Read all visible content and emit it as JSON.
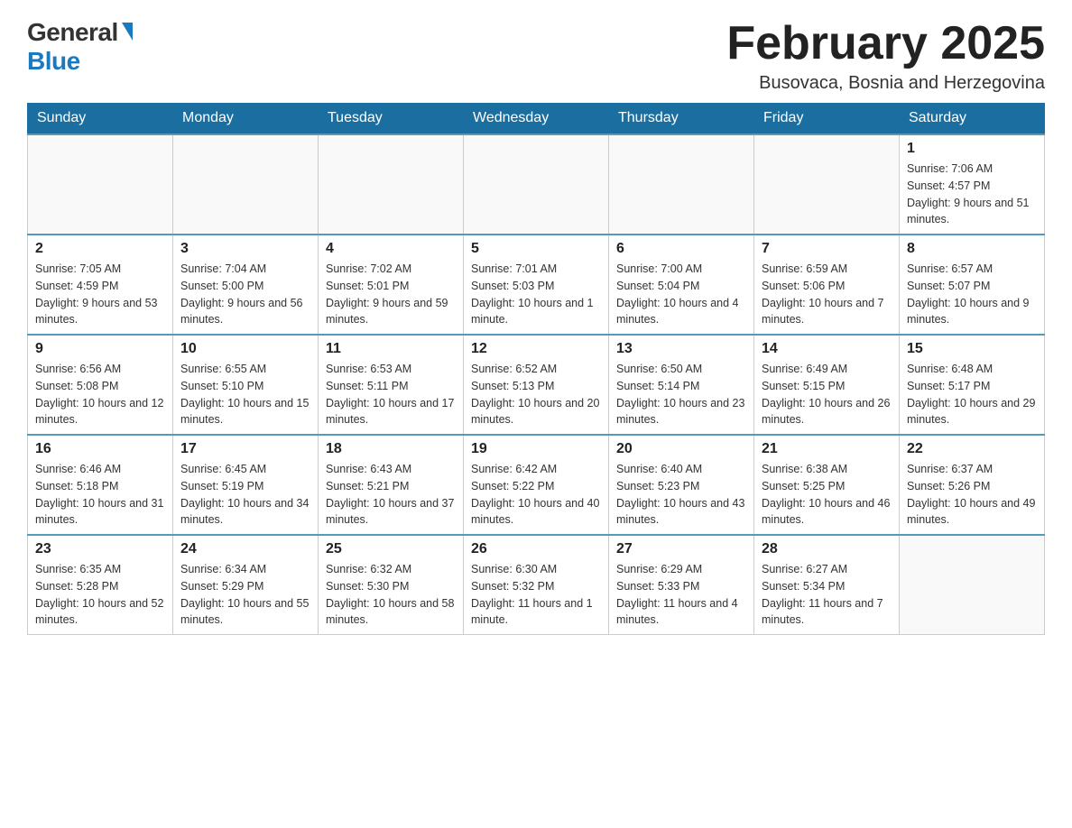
{
  "logo": {
    "general": "General",
    "blue": "Blue"
  },
  "header": {
    "title": "February 2025",
    "subtitle": "Busovaca, Bosnia and Herzegovina"
  },
  "weekdays": [
    "Sunday",
    "Monday",
    "Tuesday",
    "Wednesday",
    "Thursday",
    "Friday",
    "Saturday"
  ],
  "weeks": [
    [
      {
        "day": "",
        "info": ""
      },
      {
        "day": "",
        "info": ""
      },
      {
        "day": "",
        "info": ""
      },
      {
        "day": "",
        "info": ""
      },
      {
        "day": "",
        "info": ""
      },
      {
        "day": "",
        "info": ""
      },
      {
        "day": "1",
        "info": "Sunrise: 7:06 AM\nSunset: 4:57 PM\nDaylight: 9 hours and 51 minutes."
      }
    ],
    [
      {
        "day": "2",
        "info": "Sunrise: 7:05 AM\nSunset: 4:59 PM\nDaylight: 9 hours and 53 minutes."
      },
      {
        "day": "3",
        "info": "Sunrise: 7:04 AM\nSunset: 5:00 PM\nDaylight: 9 hours and 56 minutes."
      },
      {
        "day": "4",
        "info": "Sunrise: 7:02 AM\nSunset: 5:01 PM\nDaylight: 9 hours and 59 minutes."
      },
      {
        "day": "5",
        "info": "Sunrise: 7:01 AM\nSunset: 5:03 PM\nDaylight: 10 hours and 1 minute."
      },
      {
        "day": "6",
        "info": "Sunrise: 7:00 AM\nSunset: 5:04 PM\nDaylight: 10 hours and 4 minutes."
      },
      {
        "day": "7",
        "info": "Sunrise: 6:59 AM\nSunset: 5:06 PM\nDaylight: 10 hours and 7 minutes."
      },
      {
        "day": "8",
        "info": "Sunrise: 6:57 AM\nSunset: 5:07 PM\nDaylight: 10 hours and 9 minutes."
      }
    ],
    [
      {
        "day": "9",
        "info": "Sunrise: 6:56 AM\nSunset: 5:08 PM\nDaylight: 10 hours and 12 minutes."
      },
      {
        "day": "10",
        "info": "Sunrise: 6:55 AM\nSunset: 5:10 PM\nDaylight: 10 hours and 15 minutes."
      },
      {
        "day": "11",
        "info": "Sunrise: 6:53 AM\nSunset: 5:11 PM\nDaylight: 10 hours and 17 minutes."
      },
      {
        "day": "12",
        "info": "Sunrise: 6:52 AM\nSunset: 5:13 PM\nDaylight: 10 hours and 20 minutes."
      },
      {
        "day": "13",
        "info": "Sunrise: 6:50 AM\nSunset: 5:14 PM\nDaylight: 10 hours and 23 minutes."
      },
      {
        "day": "14",
        "info": "Sunrise: 6:49 AM\nSunset: 5:15 PM\nDaylight: 10 hours and 26 minutes."
      },
      {
        "day": "15",
        "info": "Sunrise: 6:48 AM\nSunset: 5:17 PM\nDaylight: 10 hours and 29 minutes."
      }
    ],
    [
      {
        "day": "16",
        "info": "Sunrise: 6:46 AM\nSunset: 5:18 PM\nDaylight: 10 hours and 31 minutes."
      },
      {
        "day": "17",
        "info": "Sunrise: 6:45 AM\nSunset: 5:19 PM\nDaylight: 10 hours and 34 minutes."
      },
      {
        "day": "18",
        "info": "Sunrise: 6:43 AM\nSunset: 5:21 PM\nDaylight: 10 hours and 37 minutes."
      },
      {
        "day": "19",
        "info": "Sunrise: 6:42 AM\nSunset: 5:22 PM\nDaylight: 10 hours and 40 minutes."
      },
      {
        "day": "20",
        "info": "Sunrise: 6:40 AM\nSunset: 5:23 PM\nDaylight: 10 hours and 43 minutes."
      },
      {
        "day": "21",
        "info": "Sunrise: 6:38 AM\nSunset: 5:25 PM\nDaylight: 10 hours and 46 minutes."
      },
      {
        "day": "22",
        "info": "Sunrise: 6:37 AM\nSunset: 5:26 PM\nDaylight: 10 hours and 49 minutes."
      }
    ],
    [
      {
        "day": "23",
        "info": "Sunrise: 6:35 AM\nSunset: 5:28 PM\nDaylight: 10 hours and 52 minutes."
      },
      {
        "day": "24",
        "info": "Sunrise: 6:34 AM\nSunset: 5:29 PM\nDaylight: 10 hours and 55 minutes."
      },
      {
        "day": "25",
        "info": "Sunrise: 6:32 AM\nSunset: 5:30 PM\nDaylight: 10 hours and 58 minutes."
      },
      {
        "day": "26",
        "info": "Sunrise: 6:30 AM\nSunset: 5:32 PM\nDaylight: 11 hours and 1 minute."
      },
      {
        "day": "27",
        "info": "Sunrise: 6:29 AM\nSunset: 5:33 PM\nDaylight: 11 hours and 4 minutes."
      },
      {
        "day": "28",
        "info": "Sunrise: 6:27 AM\nSunset: 5:34 PM\nDaylight: 11 hours and 7 minutes."
      },
      {
        "day": "",
        "info": ""
      }
    ]
  ]
}
